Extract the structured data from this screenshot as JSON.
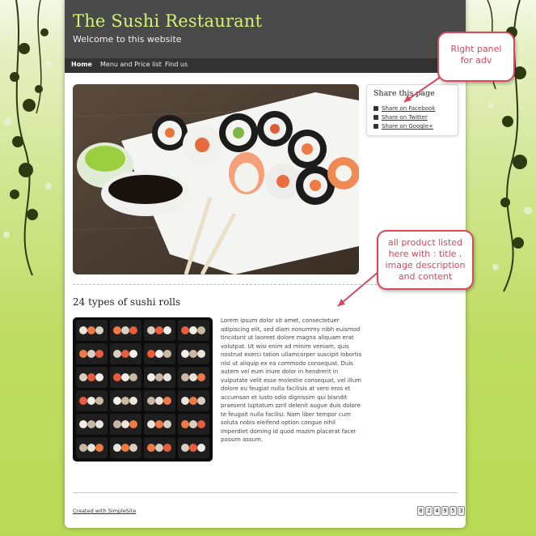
{
  "site": {
    "title": "The Sushi Restaurant",
    "tagline": "Welcome to this website"
  },
  "nav": {
    "items": [
      {
        "label": "Home",
        "active": true
      },
      {
        "label": "Menu and Price list",
        "active": false
      },
      {
        "label": "Find us",
        "active": false
      }
    ]
  },
  "main": {
    "section_title": "24 types of sushi rolls",
    "body_text": "Lorem ipsum dolor sit amet, consectetuer adipiscing elit, sed diam nonummy nibh euismod tincidunt ut laoreet dolore magna aliquam erat volutpat. Ut wisi enim ad minim veniam, quis nostrud exerci tation ullamcorper suscipit lobortis nisl ut aliquip ex ea commodo consequat. Duis autem vel eum iriure dolor in hendrerit in vulputate velit esse molestie consequat, vel illum dolore eu feugiat nulla facilisis at vero eros et accumsan et iusto odio dignissim qui blandit praesent luptatum zzril delenit augue duis dolore te feugait nulla facilisi. Nam liber tempor cum soluta nobis eleifend option congue nihil imperdiet doming id quod mazim placerat facer possim assum."
  },
  "share": {
    "title": "Share this page",
    "items": [
      {
        "label": "Share on Facebook",
        "icon": "facebook-icon"
      },
      {
        "label": "Share on Twitter",
        "icon": "twitter-icon"
      },
      {
        "label": "Share on Google+",
        "icon": "google-plus-icon"
      }
    ]
  },
  "footer": {
    "link": "Created with SimpleSite",
    "counter": [
      "0",
      "2",
      "4",
      "9",
      "5",
      "3"
    ]
  },
  "annotations": {
    "right_panel": [
      "Right panel",
      "for adv"
    ],
    "products": [
      "all product listed",
      "here with : title ,",
      "image description",
      "and content"
    ]
  },
  "colors": {
    "accent": "#d6f07a",
    "header": "#4a4a4a",
    "nav": "#333333",
    "callout": "#d9485b",
    "background": "#c0dc62"
  }
}
